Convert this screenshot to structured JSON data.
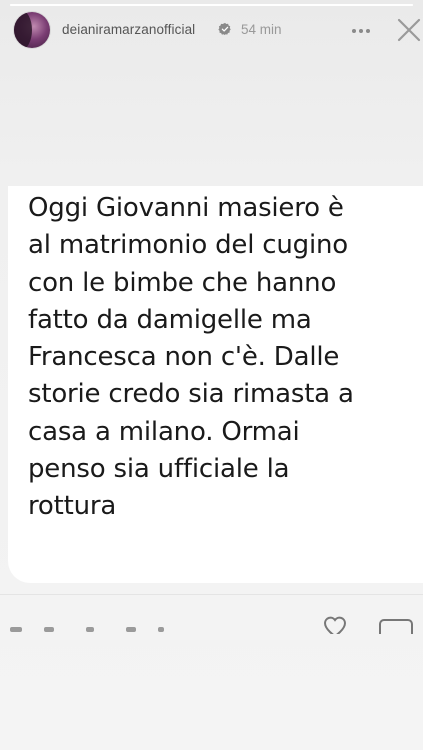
{
  "story": {
    "progress": 1.0,
    "header": {
      "username": "deianiramarzanofficial",
      "time": "54 min",
      "verified": true
    },
    "message": {
      "text": "Oggi Giovanni masiero è\nal matrimonio del cugino\ncon le bimbe che hanno\nfatto da damigelle ma\nFrancesca non c'è.  Dalle\nstorie credo sia rimasta a\ncasa a milano. Ormai\npenso sia ufficiale la\nrottura"
    },
    "icons": {
      "verified": "verified-badge-icon",
      "more": "more-options-icon",
      "close": "close-icon",
      "like": "heart-icon",
      "share": "send-icon"
    },
    "colors": {
      "background": "#f3f3f3",
      "bubble": "#ffffff",
      "text": "#1a1a1a",
      "username": "#555555",
      "time": "#999999"
    }
  }
}
